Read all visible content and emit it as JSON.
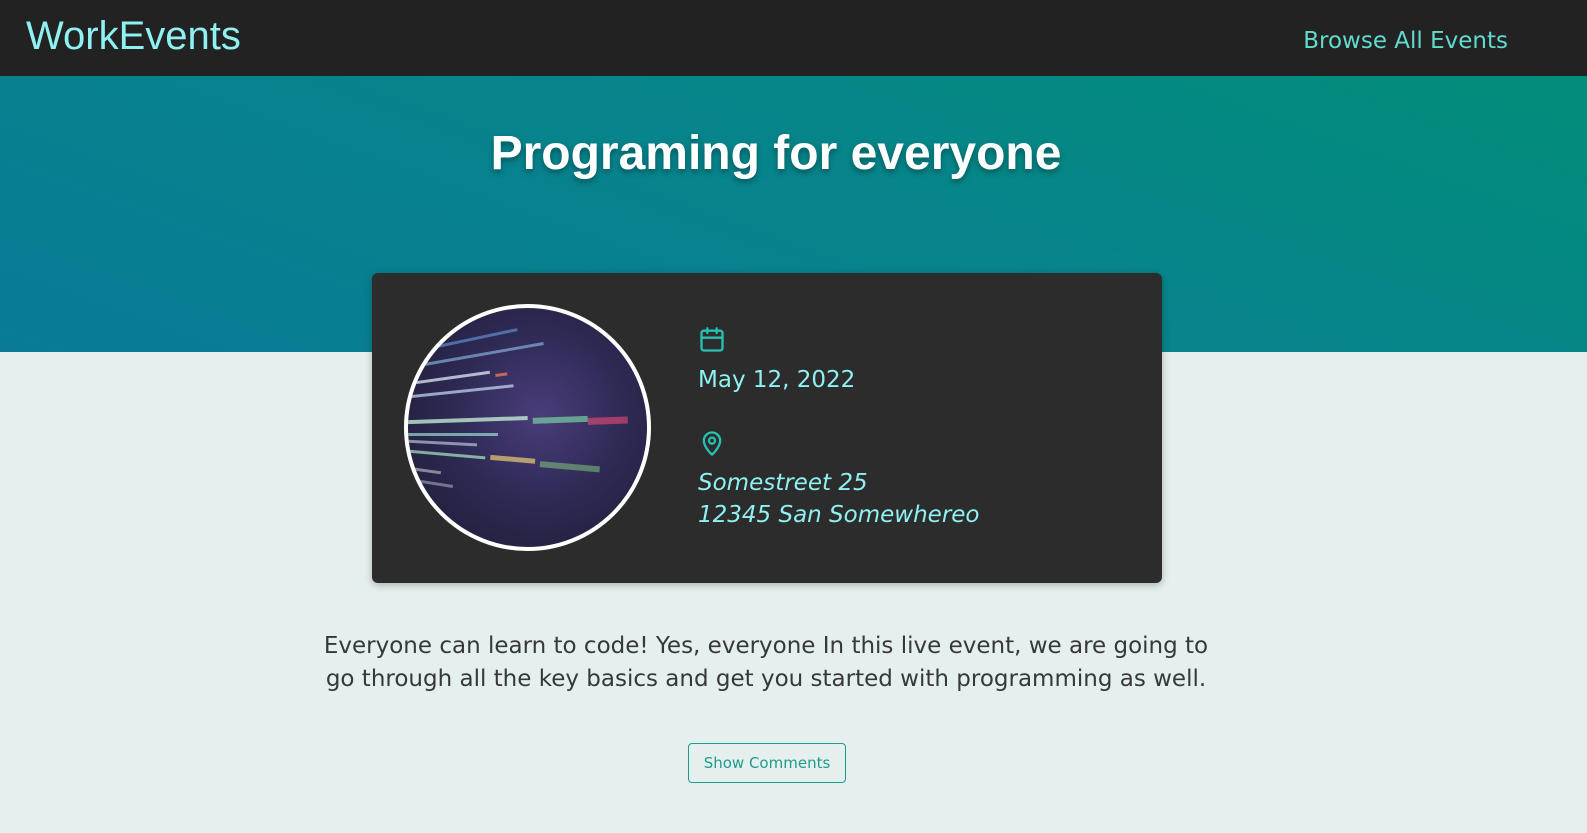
{
  "header": {
    "logo": "WorkEvents",
    "nav_link": "Browse All Events"
  },
  "hero": {
    "title": "Programing for everyone"
  },
  "event": {
    "image_alt": "Programing for everyone",
    "date": "May 12, 2022",
    "date_icon": "calendar-icon",
    "location_icon": "map-pin-icon",
    "address_street": "Somestreet 25",
    "address_city": "12345 San Somewhereo"
  },
  "description": "Everyone can learn to code! Yes, everyone In this live event, we are going to go through all the key basics and get you started with programming as well.",
  "comments_button": "Show Comments",
  "colors": {
    "navbar": "#222222",
    "logo": "#8ff1f1",
    "nav_link": "#61dbce",
    "hero_gradient_start": "#028d7a",
    "hero_gradient_end": "#097b96",
    "card": "#2c2c2c",
    "accent": "#8ff1f1",
    "icon": "#25c2b3",
    "page_background": "#e4efee",
    "button": "#1f9c8d"
  }
}
